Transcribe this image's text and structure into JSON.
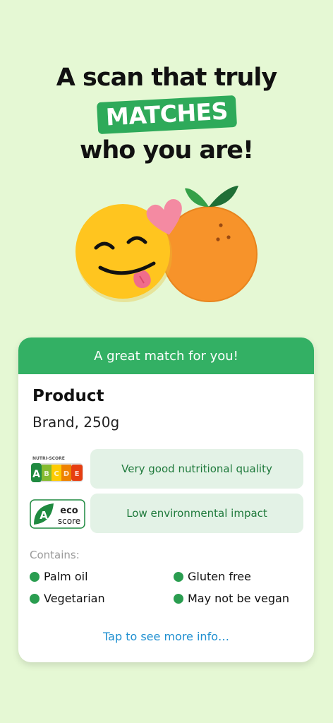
{
  "headline": {
    "line1": "A scan that truly",
    "highlight": "MATCHES",
    "line3": "who you are!"
  },
  "colors": {
    "background": "#e5f8d4",
    "accent_green": "#33b064",
    "pill_background": "#e3f2e6",
    "pill_text": "#1f7a3c",
    "link_blue": "#1e8fd0"
  },
  "illustration": {
    "icons": [
      "smiley-face-icon",
      "heart-icon",
      "orange-fruit-icon"
    ]
  },
  "card": {
    "header": "A great match for you!",
    "product_name": "Product",
    "product_brand": "Brand, 250g",
    "nutri_score": {
      "badge_label": "NUTRI-SCORE",
      "grades": [
        "A",
        "B",
        "C",
        "D",
        "E"
      ],
      "selected": "A",
      "description": "Very good nutritional quality"
    },
    "eco_score": {
      "grade": "A",
      "word1": "eco",
      "word2": "score",
      "description": "Low environmental impact"
    },
    "contains_label": "Contains:",
    "tags": [
      "Palm oil",
      "Gluten free",
      "Vegetarian",
      "May not be vegan"
    ],
    "more_link": "Tap to see more info…"
  }
}
